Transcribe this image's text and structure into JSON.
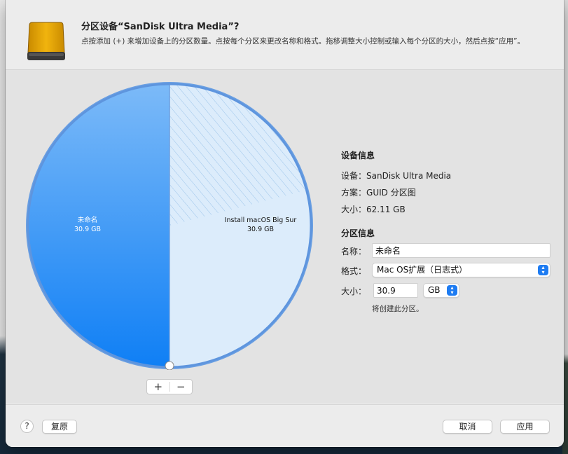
{
  "dialog": {
    "title": "分区设备“SanDisk Ultra Media”?",
    "description": "点按添加 (+) 来增加设备上的分区数量。点按每个分区来更改名称和格式。拖移调整大小控制或输入每个分区的大小，然后点按“应用”。",
    "icon": "external-drive-icon"
  },
  "pie": {
    "partitions": [
      {
        "name": "未命名",
        "size": "30.9 GB",
        "fraction": 0.5,
        "color": "#1e88f5",
        "selected": true
      },
      {
        "name": "Install macOS Big Sur",
        "size": "30.9 GB",
        "fraction": 0.5,
        "color": "#dcecfb",
        "selected": false
      }
    ],
    "add_label": "+",
    "remove_label": "−"
  },
  "device_info": {
    "section_title": "设备信息",
    "device_label": "设备：",
    "device_value": "SanDisk Ultra Media",
    "scheme_label": "方案：",
    "scheme_value": "GUID 分区图",
    "size_label": "大小：",
    "size_value": "62.11 GB"
  },
  "partition_info": {
    "section_title": "分区信息",
    "name_label": "名称：",
    "name_value": "未命名",
    "format_label": "格式：",
    "format_value": "Mac OS扩展（日志式）",
    "size_label": "大小：",
    "size_value": "30.9",
    "unit_value": "GB",
    "hint": "将创建此分区。"
  },
  "footer": {
    "help_label": "?",
    "revert_label": "复原",
    "cancel_label": "取消",
    "apply_label": "应用"
  },
  "colors": {
    "accent": "#1e7cf2",
    "selected_partition": "#1e88f5",
    "free_partition": "#dcecfb"
  }
}
